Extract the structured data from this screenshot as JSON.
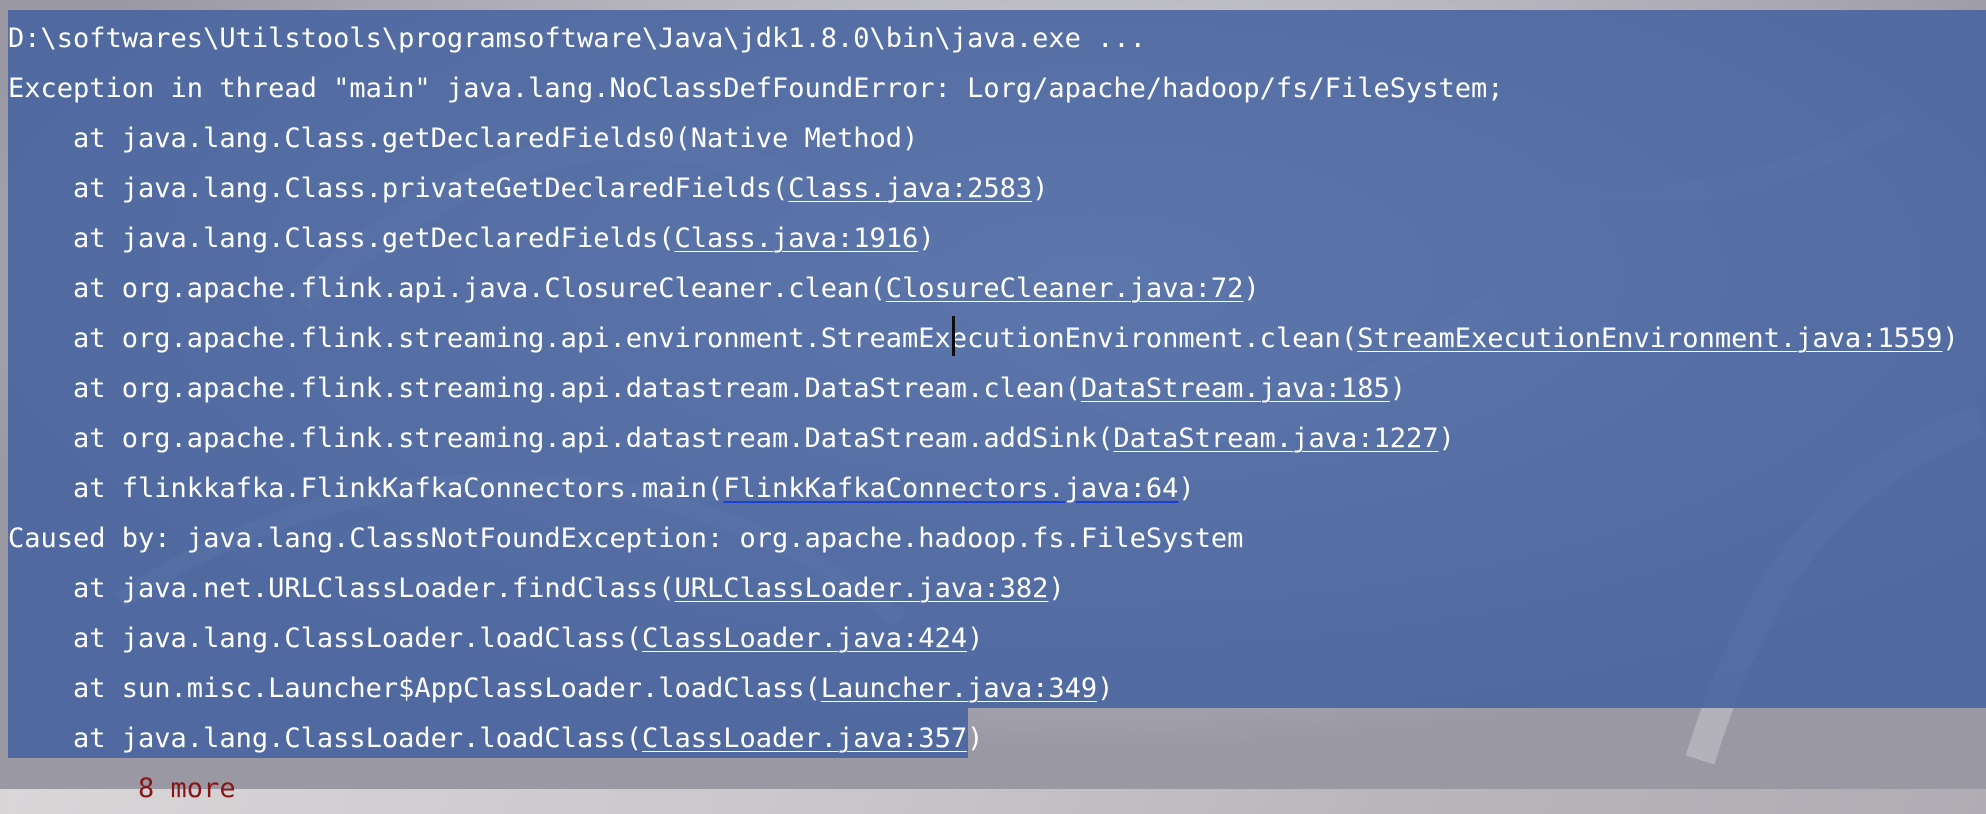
{
  "console": {
    "command": "D:\\softwares\\Utilstools\\programsoftware\\Java\\jdk1.8.0\\bin\\java.exe ...",
    "exception": "Exception in thread \"main\" java.lang.NoClassDefFoundError: Lorg/apache/hadoop/fs/FileSystem;",
    "frames": [
      {
        "prefix": "    at java.lang.Class.getDeclaredFields0(Native Method)",
        "link": "",
        "suffix": ""
      },
      {
        "prefix": "    at java.lang.Class.privateGetDeclaredFields(",
        "link": "Class.java:2583",
        "suffix": ")"
      },
      {
        "prefix": "    at java.lang.Class.getDeclaredFields(",
        "link": "Class.java:1916",
        "suffix": ")"
      },
      {
        "prefix": "    at org.apache.flink.api.java.ClosureCleaner.clean(",
        "link": "ClosureCleaner.java:72",
        "suffix": ")"
      },
      {
        "prefix": "    at org.apache.flink.streaming.api.environment.StreamExecutionEnvironment.clean(",
        "link": "StreamExecutionEnvironment.java:1559",
        "suffix": ")"
      },
      {
        "prefix": "    at org.apache.flink.streaming.api.datastream.DataStream.clean(",
        "link": "DataStream.java:185",
        "suffix": ")"
      },
      {
        "prefix": "    at org.apache.flink.streaming.api.datastream.DataStream.addSink(",
        "link": "DataStream.java:1227",
        "suffix": ")"
      },
      {
        "prefix": "    at flinkkafka.FlinkKafkaConnectors.main(",
        "link": "FlinkKafkaConnectors.java:64",
        "suffix": ")"
      }
    ],
    "caused_by": "Caused by: java.lang.ClassNotFoundException: org.apache.hadoop.fs.FileSystem",
    "cause_frames": [
      {
        "prefix": "    at java.net.URLClassLoader.findClass(",
        "link": "URLClassLoader.java:382",
        "suffix": ")"
      },
      {
        "prefix": "    at java.lang.ClassLoader.loadClass(",
        "link": "ClassLoader.java:424",
        "suffix": ")"
      },
      {
        "prefix": "    at sun.misc.Launcher$AppClassLoader.loadClass(",
        "link": "Launcher.java:349",
        "suffix": ")"
      },
      {
        "prefix": "    at java.lang.ClassLoader.loadClass(",
        "link": "ClassLoader.java:357",
        "suffix": ")"
      }
    ],
    "more": "        8 more"
  },
  "colors": {
    "selection": "#4462a0",
    "text": "#ffffff",
    "more_text": "#8a1515",
    "active_link_underline": "#1a3fd6"
  }
}
